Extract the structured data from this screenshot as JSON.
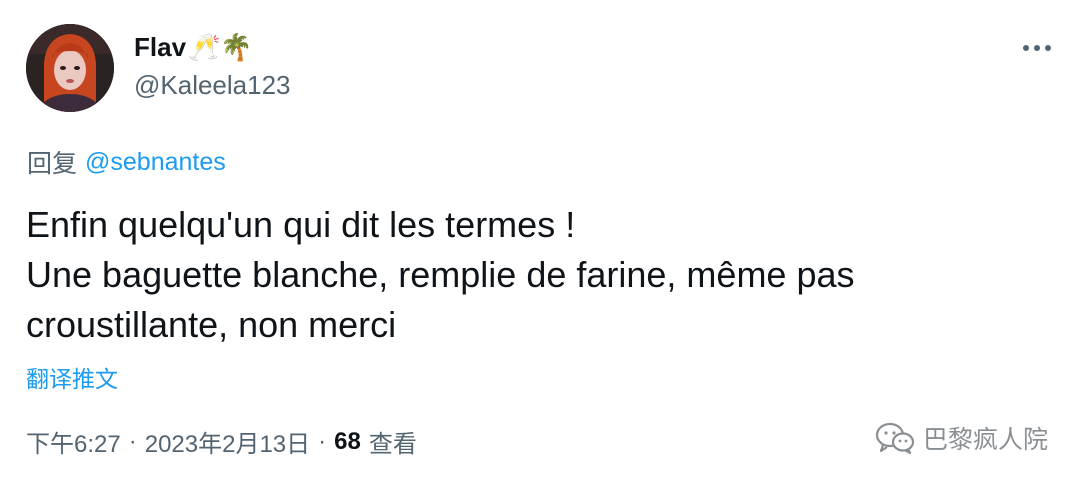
{
  "author": {
    "display_name": "Flav",
    "emoji_glyphs": "🥂🌴",
    "handle": "@Kaleela123"
  },
  "reply": {
    "prefix": "回复",
    "mention": "@sebnantes"
  },
  "tweet": {
    "lines": [
      "Enfin quelqu'un qui dit les termes !",
      "Une baguette blanche, remplie de farine, même pas",
      "croustillante, non merci"
    ],
    "translate_label": "翻译推文"
  },
  "meta": {
    "time": "下午6:27",
    "separator": "·",
    "date": "2023年2月13日",
    "views_count": "68",
    "views_label": "查看"
  },
  "watermark": {
    "text": "巴黎疯人院",
    "icon": "wechat-icon"
  },
  "icons": {
    "more": "more-dots-icon"
  },
  "colors": {
    "link": "#1d9bf0",
    "secondary_text": "#536471",
    "primary_text": "#0f1419",
    "background": "#ffffff"
  }
}
